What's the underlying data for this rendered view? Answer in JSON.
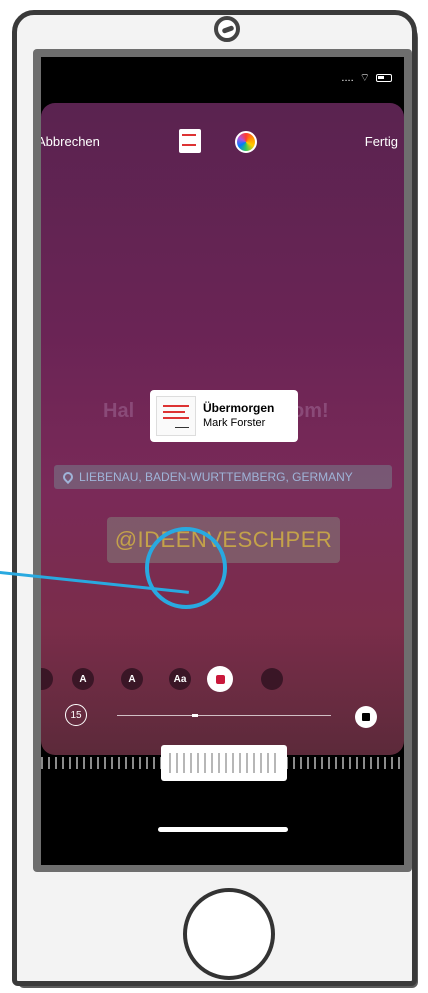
{
  "status": {
    "signal": "....",
    "wifi_glyph": "⌔"
  },
  "toolbar": {
    "cancel_label": "Abbrechen",
    "done_label": "Fertig"
  },
  "icons": {
    "sticker": "music-sticker-icon",
    "color": "color-wheel-icon"
  },
  "background_text": {
    "left": "Hal",
    "right": "om!"
  },
  "music": {
    "song": "Übermorgen",
    "artist": "Mark Forster"
  },
  "location_label": "LIEBENAU, BADEN-WURTTEMBERG, GERMANY",
  "mention_label": "@IDEENVESCHPER",
  "tools": {
    "ai_label": "A",
    "a1_label": "A",
    "a2_label": "Aa"
  },
  "timer_label": "15",
  "colors": {
    "accent_ring": "#29a9e0",
    "record": "#c9183b"
  }
}
